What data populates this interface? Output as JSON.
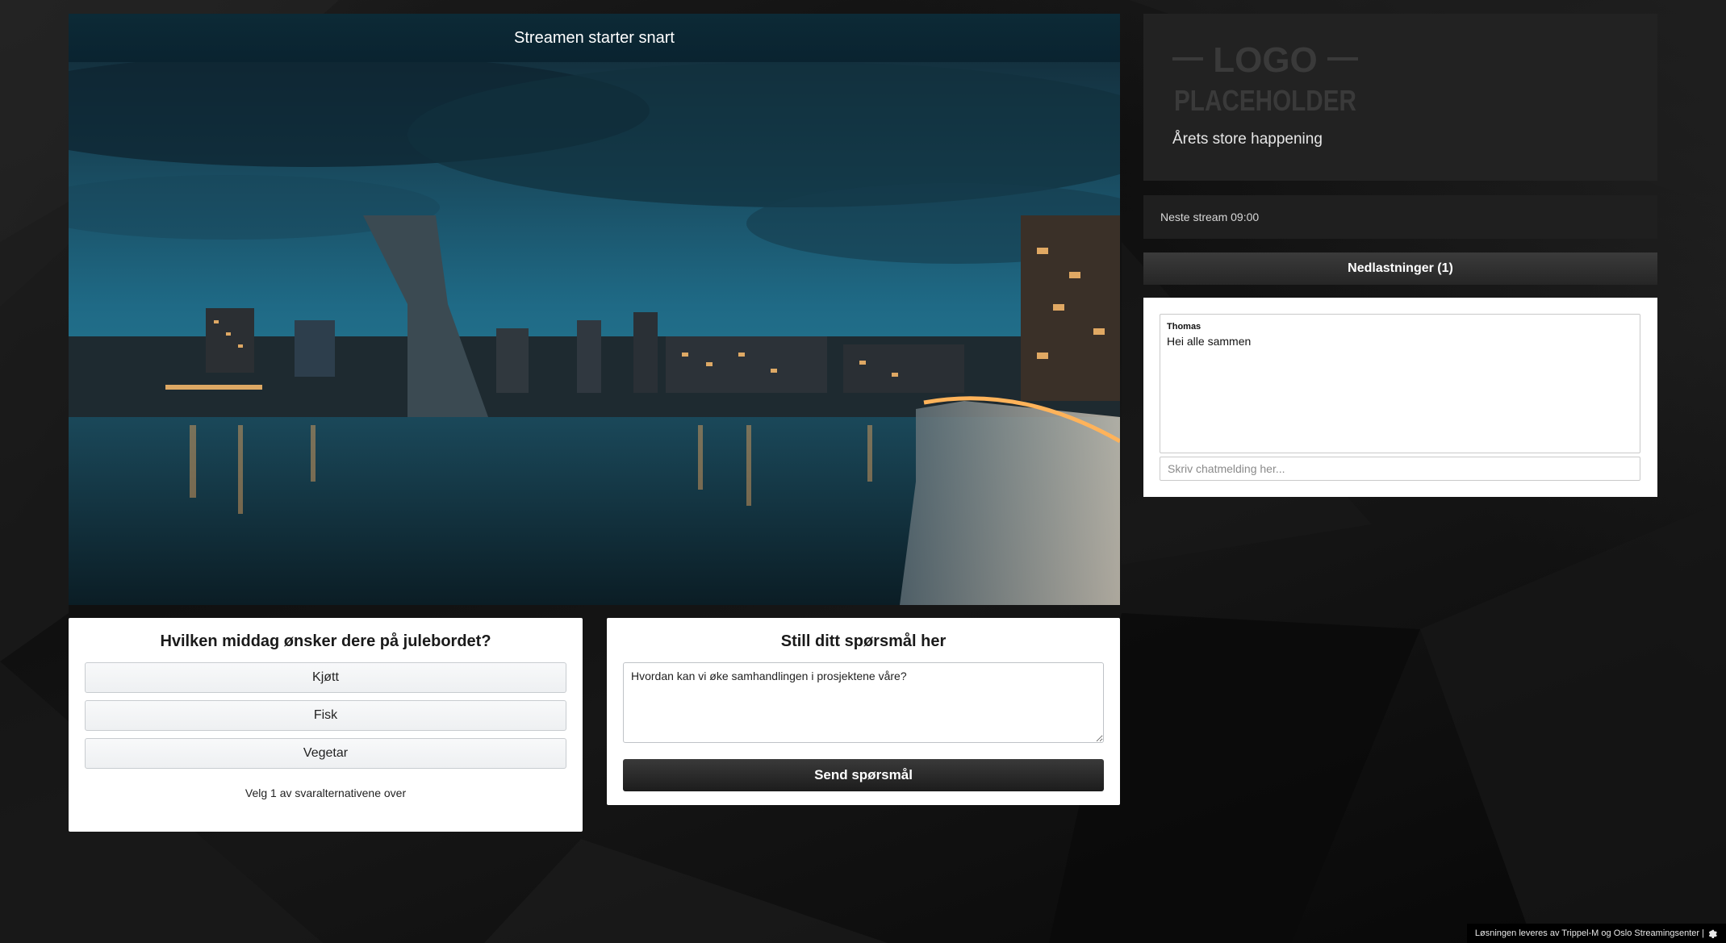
{
  "video": {
    "header": "Streamen starter snart"
  },
  "poll": {
    "question": "Hvilken middag ønsker dere på julebordet?",
    "options": [
      "Kjøtt",
      "Fisk",
      "Vegetar"
    ],
    "hint": "Velg 1 av svaralternativene over"
  },
  "question_form": {
    "title": "Still ditt spørsmål her",
    "value": "Hvordan kan vi øke samhandlingen i prosjektene våre?",
    "submit_label": "Send spørsmål"
  },
  "logo": {
    "line1": "LOGO",
    "line2": "PLACEHOLDER"
  },
  "event": {
    "title": "Årets store happening",
    "next_stream": "Neste stream 09:00"
  },
  "downloads": {
    "label": "Nedlastninger (1)"
  },
  "chat": {
    "messages": [
      {
        "author": "Thomas",
        "text": "Hei alle sammen"
      }
    ],
    "input_placeholder": "Skriv chatmelding her..."
  },
  "footer": {
    "text": "Løsningen leveres av Trippel-M og Oslo Streamingsenter |"
  },
  "icons": {
    "settings": "gear-icon"
  },
  "colors": {
    "page_bg": "#111111",
    "video_header_bg": "#0c2a36",
    "button_dark": "#2a2a2a"
  }
}
